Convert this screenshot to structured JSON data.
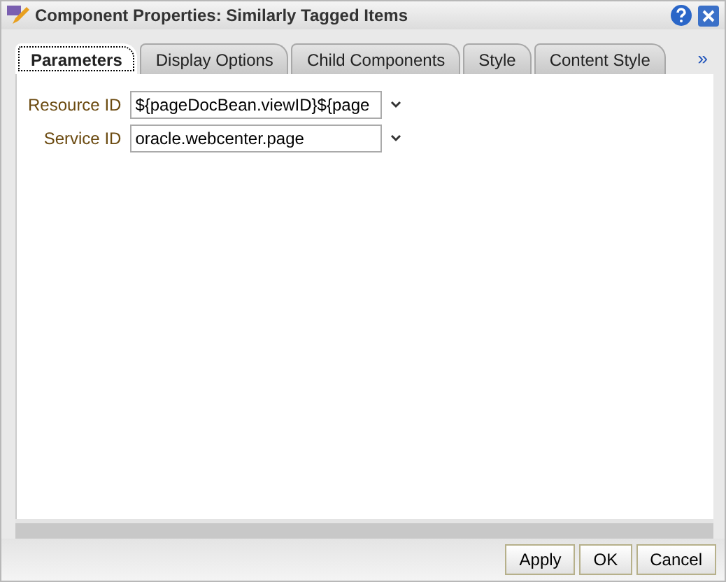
{
  "window": {
    "title": "Component Properties: Similarly Tagged Items"
  },
  "tabs": [
    {
      "label": "Parameters",
      "selected": true
    },
    {
      "label": "Display Options",
      "selected": false
    },
    {
      "label": "Child Components",
      "selected": false
    },
    {
      "label": "Style",
      "selected": false
    },
    {
      "label": "Content Style",
      "selected": false
    }
  ],
  "more_tabs": "»",
  "fields": [
    {
      "label": "Resource ID",
      "value": "${pageDocBean.viewID}${page"
    },
    {
      "label": "Service ID",
      "value": "oracle.webcenter.page"
    }
  ],
  "buttons": [
    "Apply",
    "OK",
    "Cancel"
  ]
}
